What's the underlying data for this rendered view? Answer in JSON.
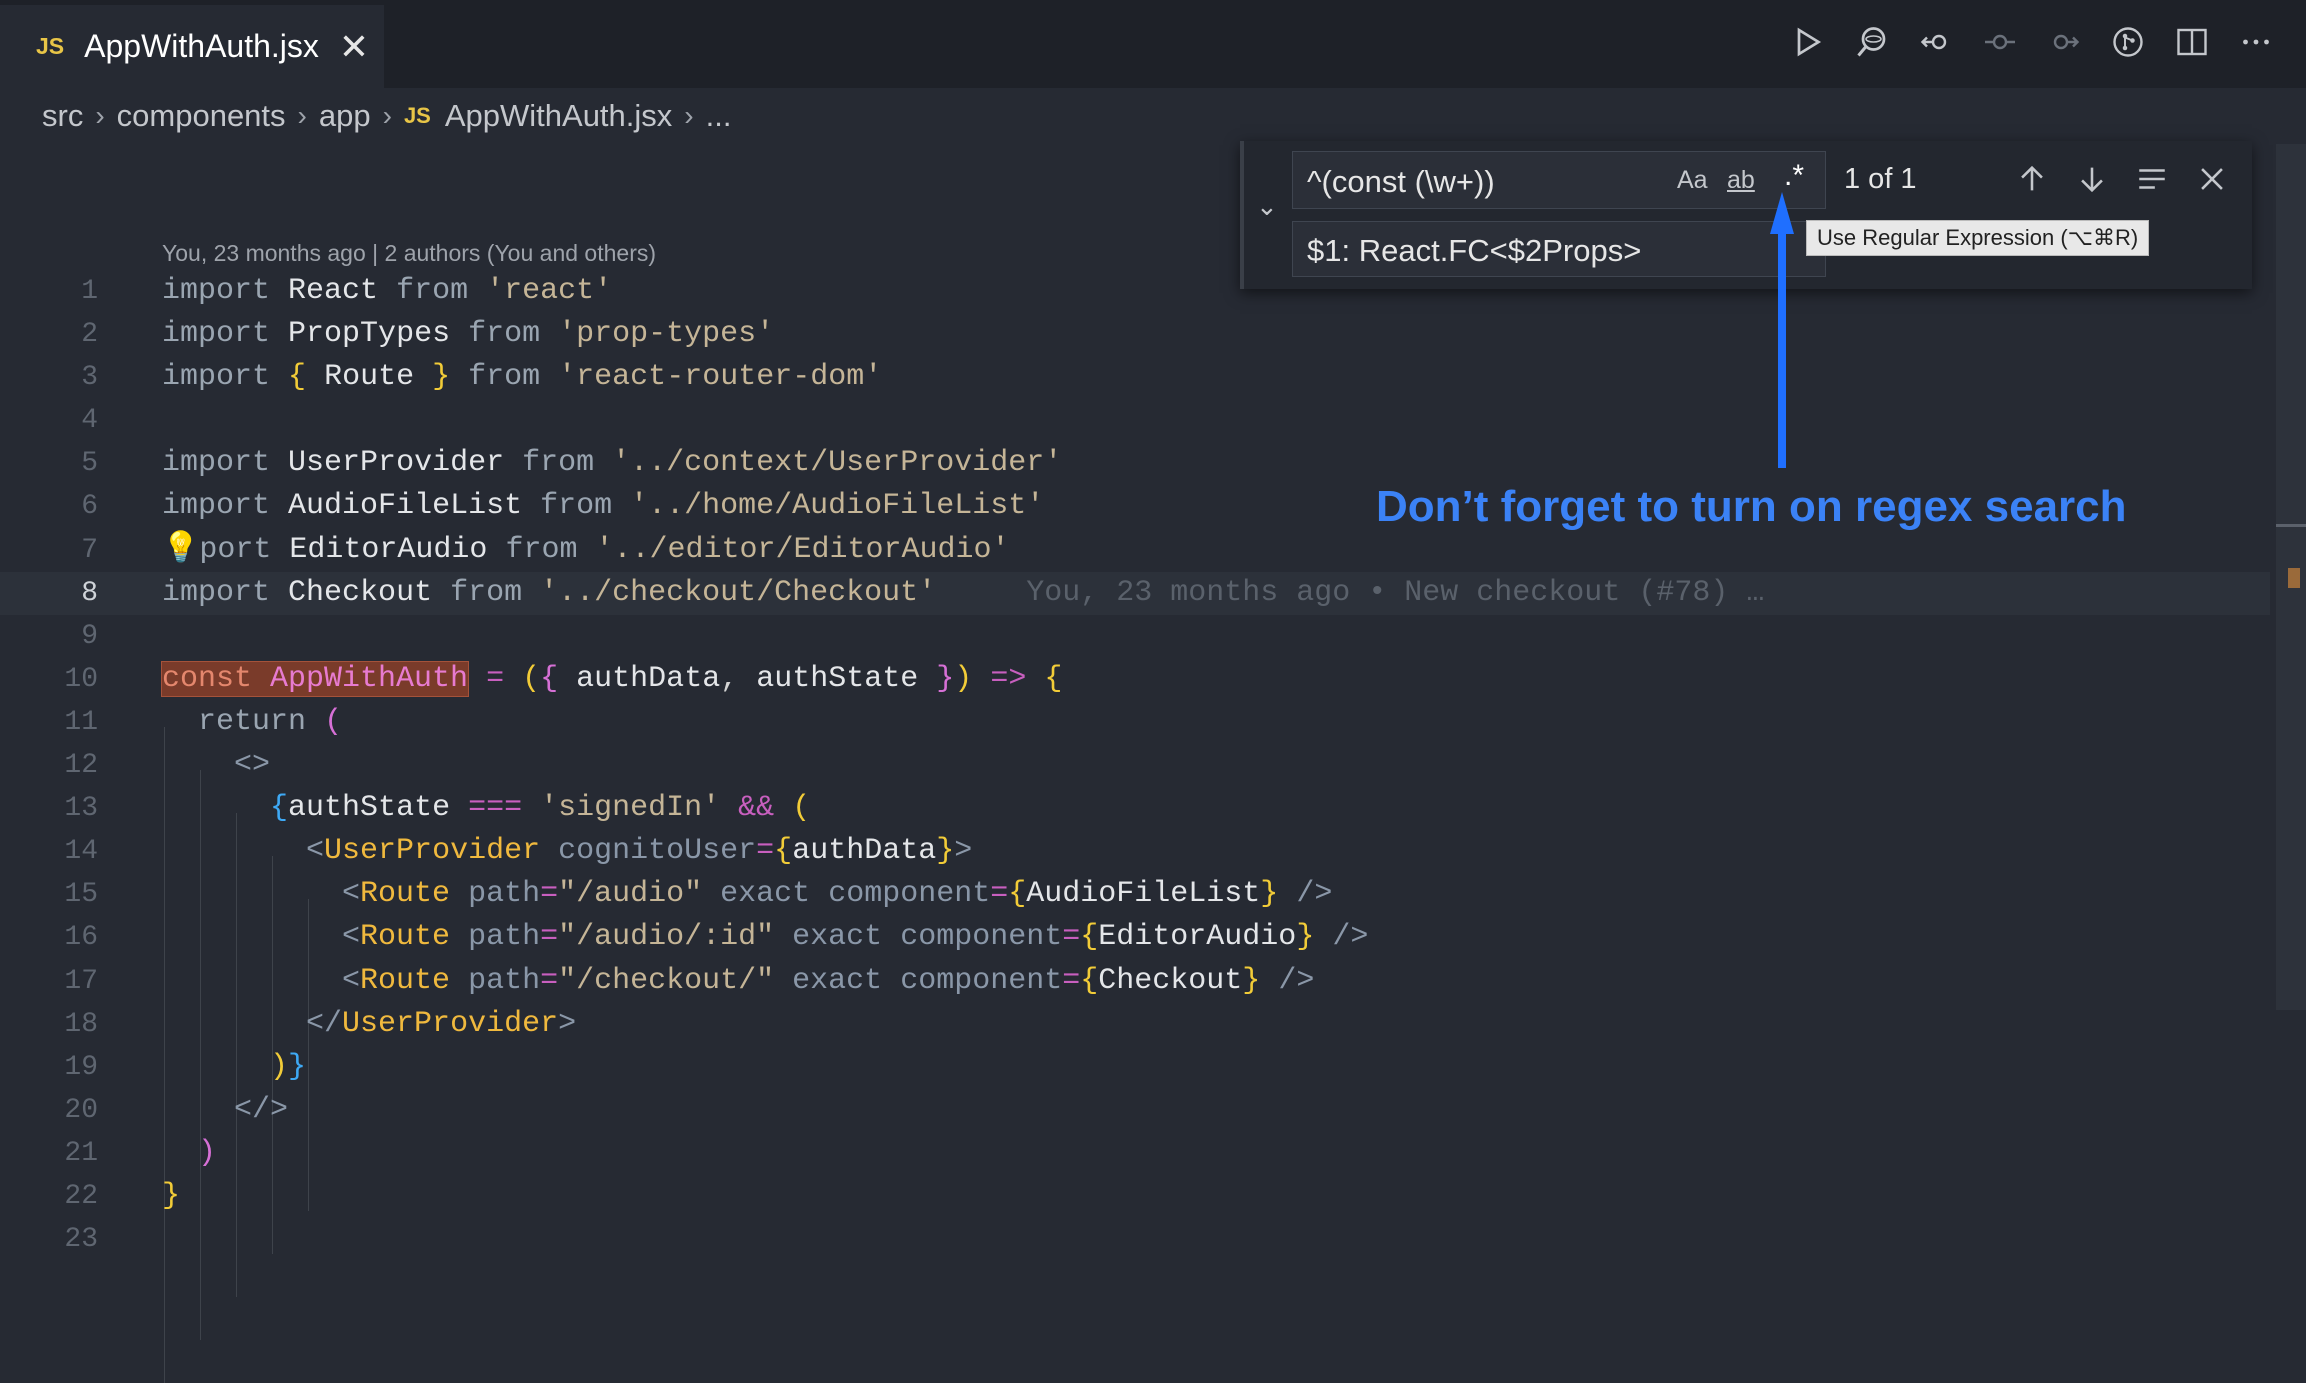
{
  "tab": {
    "badge": "JS",
    "title": "AppWithAuth.jsx"
  },
  "toolbar_icons": [
    "run-icon",
    "search-react-icon",
    "go-back-icon",
    "commit-icon",
    "go-forward-icon",
    "git-icon",
    "split-editor-icon",
    "more-icon"
  ],
  "breadcrumb": {
    "parts": [
      "src",
      "components",
      "app"
    ],
    "file_badge": "JS",
    "file": "AppWithAuth.jsx",
    "trailing": "..."
  },
  "blame_header": "You, 23 months ago | 2 authors (You and others)",
  "find": {
    "query": "^(const (\\w+))",
    "replace": "$1: React.FC<$2Props>",
    "match_case": "Aa",
    "whole_word": "ab",
    "regex": ".*",
    "count": "1 of 1"
  },
  "tooltip": "Use Regular Expression (⌥⌘R)",
  "callout": "Don’t forget to turn on regex search",
  "colors": {
    "callout": "#3b82f6",
    "match_highlight": "#7a3b2a"
  },
  "code": {
    "line_numbers": [
      "1",
      "2",
      "3",
      "4",
      "5",
      "6",
      "7",
      "8",
      "9",
      "10",
      "11",
      "12",
      "13",
      "14",
      "15",
      "16",
      "17",
      "18",
      "19",
      "20",
      "21",
      "22",
      "23"
    ],
    "inline_blame": "You, 23 months ago • New checkout (#78) …"
  }
}
